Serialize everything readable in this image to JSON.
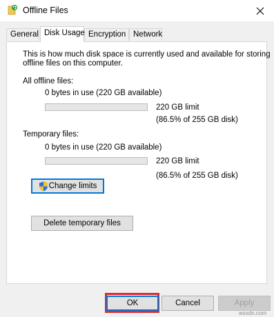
{
  "window": {
    "title": "Offline Files"
  },
  "tabs": [
    {
      "label": "General"
    },
    {
      "label": "Disk Usage"
    },
    {
      "label": "Encryption"
    },
    {
      "label": "Network"
    }
  ],
  "active_tab": "Disk Usage",
  "description": "This is how much disk space is currently used and available for storing offline files on this computer.",
  "description_lines": [
    "This is how much disk space is currently used and available for storing",
    "offline files on this computer."
  ],
  "all_offline": {
    "heading": "All offline files:",
    "usage": "0 bytes in use (220 GB available)",
    "limit": "220 GB limit",
    "percent": "(86.5% of 255 GB disk)",
    "used_fraction": 0
  },
  "temporary": {
    "heading": "Temporary files:",
    "usage": "0 bytes in use (220 GB available)",
    "limit": "220 GB limit",
    "percent": "(86.5% of 255 GB disk)",
    "used_fraction": 0
  },
  "buttons": {
    "change_limits": "Change limits",
    "delete_temporary": "Delete temporary files",
    "ok": "OK",
    "cancel": "Cancel",
    "apply": "Apply"
  },
  "icons": {
    "app": "offline-files-sync-icon",
    "close": "close-icon",
    "shield": "uac-shield-icon"
  },
  "colors": {
    "highlight": "#e0282e",
    "focus": "#0078d7",
    "sync_green": "#21a038"
  },
  "watermark": "wsxdn.com"
}
